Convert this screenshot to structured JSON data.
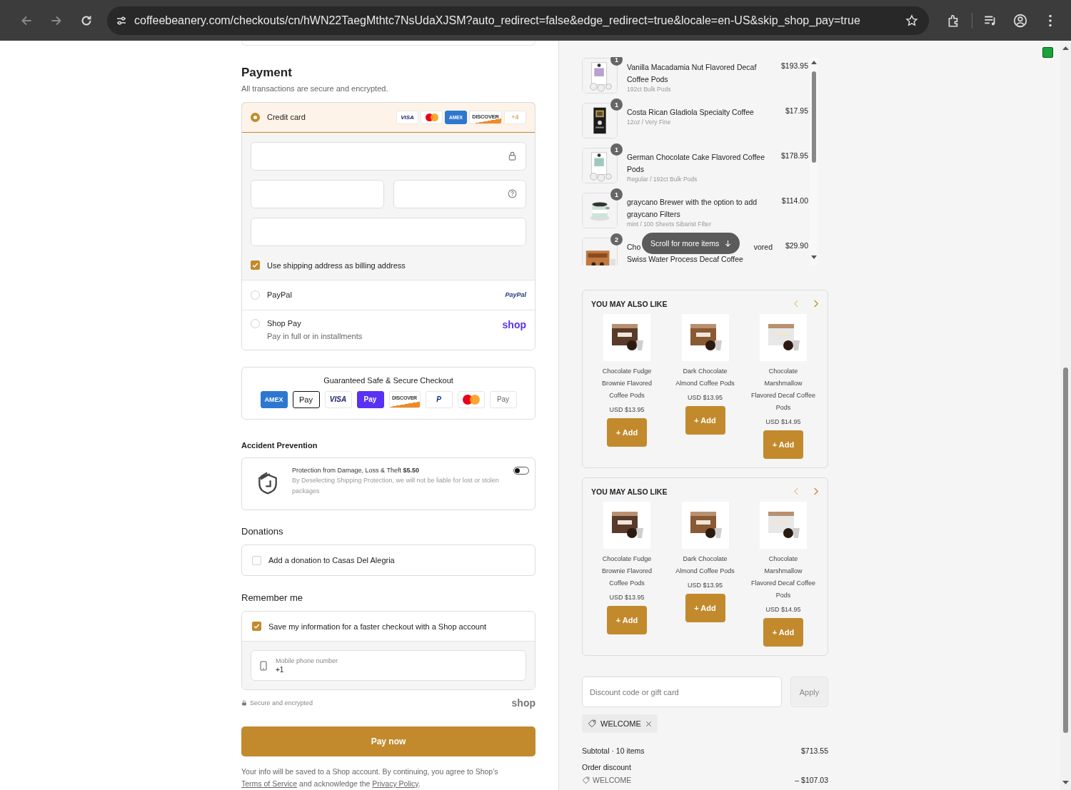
{
  "browser": {
    "url": "coffeebeanery.com/checkouts/cn/hWN22TaegMthtc7NsUdaXJSM?auto_redirect=false&edge_redirect=true&locale=en-US&skip_shop_pay=true"
  },
  "payment": {
    "title": "Payment",
    "subtitle": "All transactions are secure and encrypted.",
    "methods": [
      {
        "kind": "card",
        "label": "Credit card",
        "selected": true,
        "brands": [
          {
            "kind": "visa",
            "label": "VISA"
          },
          {
            "kind": "mastercard"
          },
          {
            "kind": "amex",
            "label": "AMEX"
          },
          {
            "kind": "discover",
            "label": "DISCOVER"
          },
          {
            "kind": "more",
            "label": "+4"
          }
        ],
        "billing": {
          "label": "Use shipping address as billing address",
          "checked": true
        }
      },
      {
        "kind": "paypal",
        "label": "PayPal",
        "logo": "PayPal",
        "selected": false
      },
      {
        "kind": "shoppay",
        "label": "Shop Pay",
        "note": "Pay in full or in installments",
        "logo": "shop",
        "selected": false
      }
    ]
  },
  "secure_checkout": {
    "title": "Guaranteed Safe & Secure Checkout",
    "badges": [
      {
        "kind": "amex",
        "label": "AMEX"
      },
      {
        "kind": "applepay",
        "label": "Pay"
      },
      {
        "kind": "visa",
        "label": "VISA"
      },
      {
        "kind": "shoppay",
        "label": "Pay"
      },
      {
        "kind": "discover",
        "label": "DISCOVER"
      },
      {
        "kind": "paypal",
        "label": "P"
      },
      {
        "kind": "mastercard"
      },
      {
        "kind": "gpay",
        "label": "Pay"
      }
    ]
  },
  "accident": {
    "title": "Accident Prevention",
    "heading": "Protection from Damage, Loss & Theft **$5.50**",
    "text": "By Deselecting Shipping Protection, we will not be liable for lost or stolen packages",
    "on": false
  },
  "donations": {
    "title": "Donations",
    "label": "Add a donation to Casas Del Alegria",
    "checked": false
  },
  "remember": {
    "title": "Remember me",
    "label": "Save my information for a faster checkout with a Shop account",
    "checked": true,
    "phone_label": "Mobile phone number",
    "phone_value": "+1"
  },
  "secure_note": "Secure and encrypted",
  "shop_logo": "shop",
  "pay_button": "Pay now",
  "footer": {
    "text": "Your info will be saved to a Shop account. By continuing, you agree to Shop’s",
    "terms": "Terms of Service",
    "middle": "and acknowledge the",
    "privacy": "Privacy Policy",
    "end": "."
  },
  "cart": {
    "items": [
      {
        "qty": "1",
        "name": "Vanilla Macadamia Nut Flavored Decaf Coffee Pods",
        "variant": "192ct Bulk Pods",
        "price": "$193.95"
      },
      {
        "qty": "1",
        "name": "Costa Rican Gladiola Specialty Coffee",
        "variant": "12oz / Very Fine",
        "price": "$17.95"
      },
      {
        "qty": "1",
        "name": "German Chocolate Cake Flavored Coffee Pods",
        "variant": "Regular / 192ct Bulk Pods",
        "price": "$178.95"
      },
      {
        "qty": "1",
        "name": "graycano Brewer with the option to add graycano Filters",
        "variant": "mint / 100 Sheets Sibarist Filter",
        "price": "$114.00"
      },
      {
        "qty": "2",
        "name": "Cho",
        "name_end": "vored",
        "name_line2": "Swiss Water Process Decaf Coffee",
        "price": "$29.90"
      }
    ],
    "scroll_hint": "Scroll for more items"
  },
  "recommendations": [
    {
      "title": "YOU MAY ALSO LIKE",
      "products": [
        {
          "name": "Chocolate Fudge Brownie Flavored Coffee Pods",
          "price": "USD $13.95",
          "button": "+ Add"
        },
        {
          "name": "Dark Chocolate Almond Coffee Pods",
          "price": "USD $13.95",
          "button": "+ Add"
        },
        {
          "name": "Chocolate Marshmallow Flavored Decaf Coffee Pods",
          "price": "USD $14.95",
          "button": "+ Add"
        }
      ]
    },
    {
      "title": "YOU MAY ALSO LIKE",
      "products": [
        {
          "name": "Chocolate Fudge Brownie Flavored Coffee Pods",
          "price": "USD $13.95",
          "button": "+ Add"
        },
        {
          "name": "Dark Chocolate Almond Coffee Pods",
          "price": "USD $13.95",
          "button": "+ Add"
        },
        {
          "name": "Chocolate Marshmallow Flavored Decaf Coffee Pods",
          "price": "USD $14.95",
          "button": "+ Add"
        }
      ]
    }
  ],
  "discount": {
    "placeholder": "Discount code or gift card",
    "button": "Apply",
    "applied": "WELCOME"
  },
  "summary": {
    "subtotal_label": "Subtotal · 10 items",
    "subtotal": "$713.55",
    "discount_label": "Order discount",
    "discount_code": "WELCOME",
    "discount_value": "– $107.03"
  }
}
